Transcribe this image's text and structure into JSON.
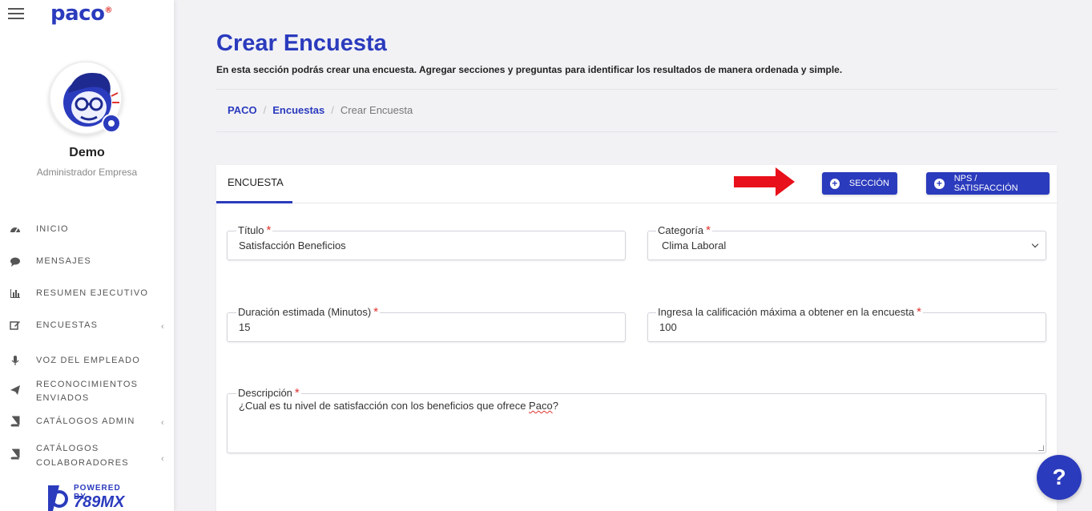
{
  "sidebar": {
    "logo": "paco",
    "logo_mark": "®",
    "user_name": "Demo",
    "user_role": "Administrador Empresa",
    "items": [
      {
        "label": "INICIO",
        "icon": "dashboard-icon"
      },
      {
        "label": "MENSAJES",
        "icon": "chat-icon"
      },
      {
        "label": "RESUMEN EJECUTIVO",
        "icon": "bar-chart-icon"
      },
      {
        "label": "ENCUESTAS",
        "icon": "edit-icon",
        "expandable": true
      },
      {
        "label": "VOZ DEL EMPLEADO",
        "icon": "microphone-icon"
      },
      {
        "label": "RECONOCIMIENTOS",
        "label2": "ENVIADOS",
        "icon": "paper-plane-icon"
      },
      {
        "label": "CATÁLOGOS ADMIN",
        "icon": "book-icon",
        "expandable": true
      },
      {
        "label": "CATÁLOGOS",
        "label2": "COLABORADORES",
        "icon": "book-icon",
        "expandable": true
      }
    ],
    "powered_top": "POWERED BY",
    "powered_brand": "789MX"
  },
  "page": {
    "title": "Crear Encuesta",
    "description": "En esta sección podrás crear una encuesta. Agregar secciones y preguntas para identificar los resultados de manera ordenada y simple."
  },
  "breadcrumb": {
    "root": "PACO",
    "section": "Encuestas",
    "current": "Crear Encuesta",
    "separator": "/"
  },
  "card": {
    "tab": "ENCUESTA",
    "section_button": "SECCIÓN",
    "nps_button": "NPS / SATISFACCIÓN"
  },
  "form": {
    "title_label": "Título",
    "title_value": "Satisfacción Beneficios",
    "category_label": "Categoría",
    "category_value": "Clima Laboral",
    "duration_label": "Duración estimada (Minutos)",
    "duration_value": "15",
    "max_score_label": "Ingresa la calificación máxima a obtener en la encuesta",
    "max_score_value": "100",
    "description_label": "Descripción",
    "description_value_pre": "¿Cual es tu nivel de satisfacción con los beneficios que ofrece ",
    "description_value_word": "Paco",
    "description_value_post": "?",
    "required_mark": "*"
  },
  "help": {
    "label": "?"
  },
  "colors": {
    "primary": "#2b3bbd",
    "accent_red": "#e0332f"
  }
}
